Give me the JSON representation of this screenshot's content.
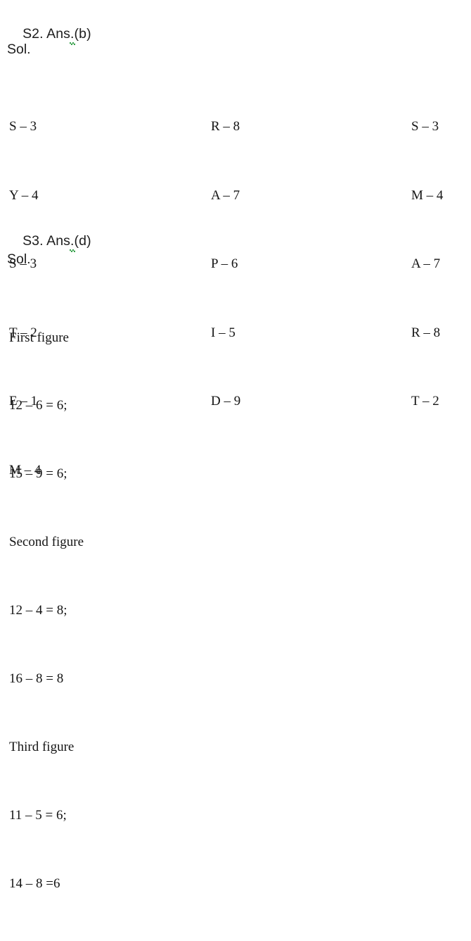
{
  "document": {
    "background_color": "#ffffff",
    "text_color": "#151515",
    "spellcheck_underline_color": "#2f9e44"
  },
  "solutions": [
    {
      "id": "s2",
      "heading_prefix": "S2. Ans",
      "heading_mark": ".",
      "heading_suffix": "(b)",
      "heading_full": "S2. Ans.(b)",
      "sol_label": "Sol.",
      "columns": [
        {
          "id": "column-1",
          "pairs": [
            "S – 3",
            "Y – 4",
            "S – 3",
            "T – 2",
            "E – 1",
            "M – 4"
          ]
        },
        {
          "id": "column-2",
          "pairs": [
            "R – 8",
            "A – 7",
            "P – 6",
            "I – 5",
            "D – 9"
          ]
        },
        {
          "id": "column-3",
          "pairs": [
            "S – 3",
            "M – 4",
            "A – 7",
            "R – 8",
            "T – 2"
          ]
        }
      ]
    },
    {
      "id": "s3",
      "heading_prefix": "S3. Ans",
      "heading_mark": ".",
      "heading_suffix": "(d)",
      "heading_full": "S3. Ans.(d)",
      "sol_label": "Sol.",
      "figures": [
        {
          "title": "First figure",
          "equations": [
            "12 – 6 = 6;",
            "15 – 9 = 6;"
          ]
        },
        {
          "title": "Second figure",
          "equations": [
            "12 – 4 = 8;",
            "16 – 8 = 8"
          ]
        },
        {
          "title": "Third figure",
          "equations": [
            "11 – 5 = 6;",
            "14 – 8 =6"
          ]
        }
      ]
    }
  ],
  "calc_lines": [
    "First figure",
    "12 – 6 = 6;",
    "15 – 9 = 6;",
    "Second figure",
    "12 – 4 = 8;",
    "16 – 8 = 8",
    "Third figure",
    "11 – 5 = 6;",
    "14 – 8 =6"
  ]
}
